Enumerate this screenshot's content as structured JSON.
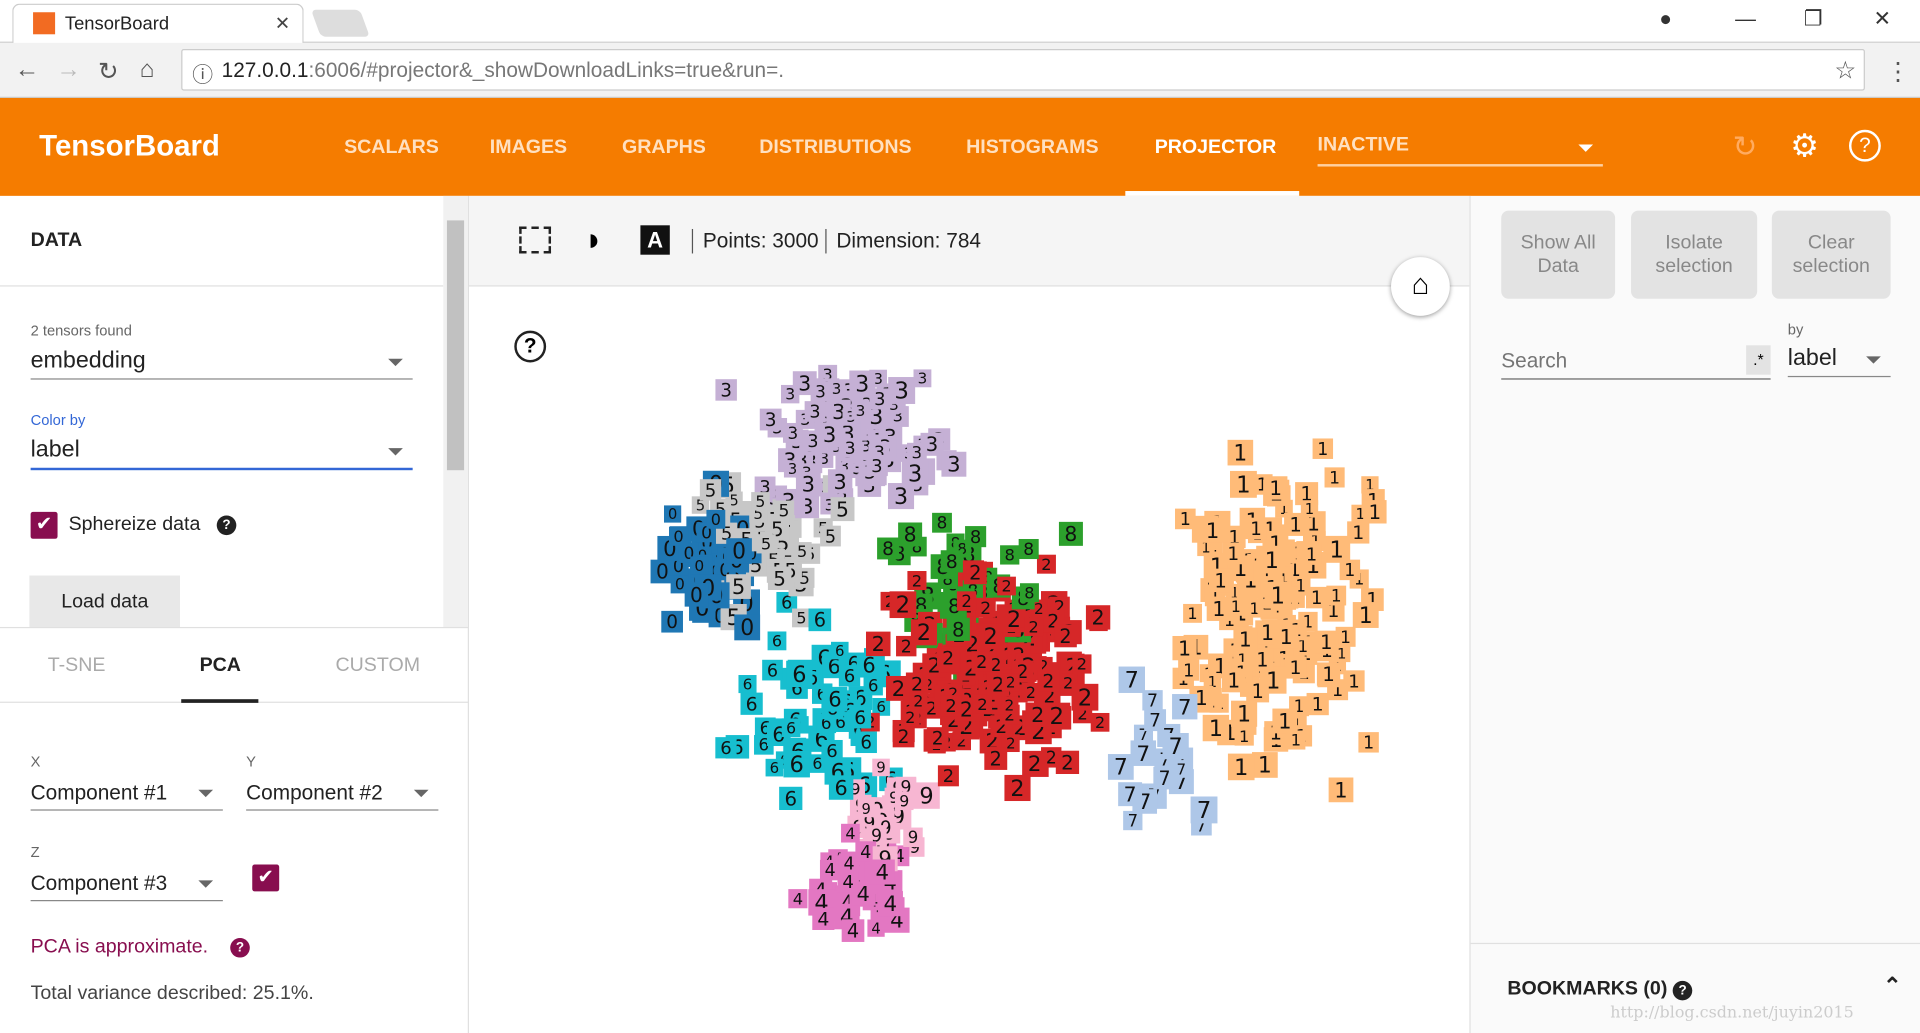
{
  "browser": {
    "tab_title": "TensorBoard",
    "url_host": "127.0.0.1",
    "url_rest": ":6006/#projector&_showDownloadLinks=true&run=."
  },
  "header": {
    "logo": "TensorBoard",
    "tabs": [
      "SCALARS",
      "IMAGES",
      "GRAPHS",
      "DISTRIBUTIONS",
      "HISTOGRAMS",
      "PROJECTOR"
    ],
    "active_tab": "PROJECTOR",
    "run_select": "INACTIVE",
    "accent": "#f57c00"
  },
  "data_panel": {
    "title": "DATA",
    "tensors_found": "2 tensors found",
    "tensor": "embedding",
    "color_by_label": "Color by",
    "color_by": "label",
    "sphereize": "Sphereize data",
    "sphereize_checked": true,
    "load_data": "Load data"
  },
  "projection": {
    "tabs": [
      "T-SNE",
      "PCA",
      "CUSTOM"
    ],
    "active": "PCA",
    "x_label": "X",
    "x": "Component #1",
    "y_label": "Y",
    "y": "Component #2",
    "z_label": "Z",
    "z": "Component #3",
    "z_checked": true,
    "approx": "PCA is approximate.",
    "variance": "Total variance described: 25.1%."
  },
  "toolbar": {
    "points": "Points: 3000",
    "dimension": "Dimension: 784"
  },
  "inspector": {
    "show_all": "Show All Data",
    "isolate": "Isolate selection",
    "clear": "Clear selection",
    "search_placeholder": "Search",
    "regex": ".*",
    "by_label": "by",
    "by": "label",
    "bookmarks": "BOOKMARKS (0)"
  },
  "label_colors": {
    "0": "#1f77b4",
    "1": "#ffbb78",
    "2": "#d62728",
    "3": "#c5b0d5",
    "4": "#e377c2",
    "5": "#c7c7c7",
    "6": "#17becf",
    "7": "#aec7e8",
    "8": "#2ca02c",
    "9": "#f7b6d2"
  },
  "watermark": "http://blog.csdn.net/juyin2015"
}
